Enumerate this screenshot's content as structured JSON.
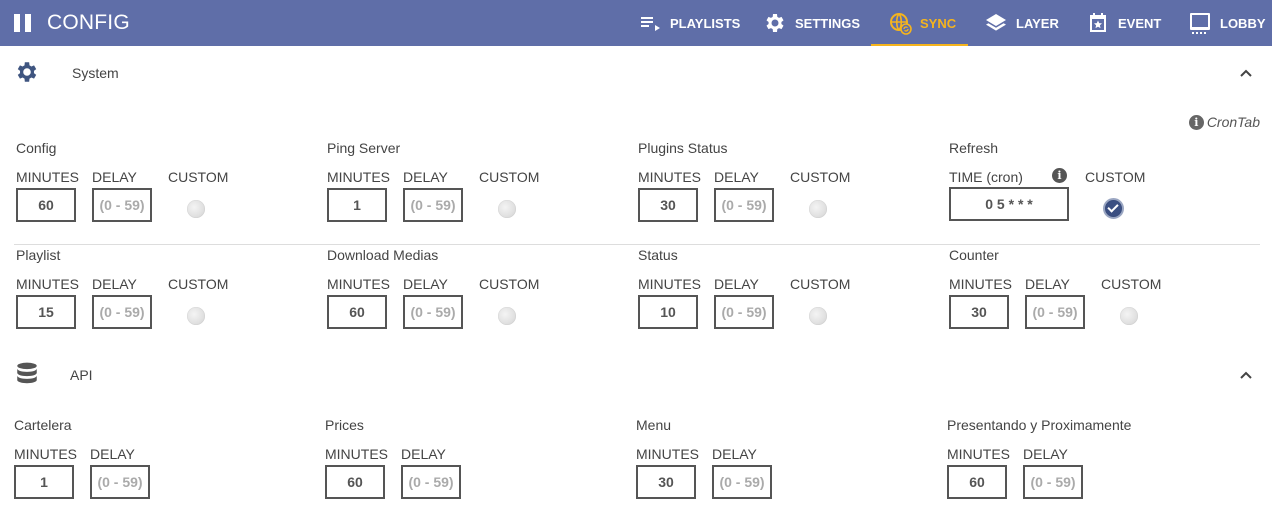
{
  "app": {
    "title": "CONFIG"
  },
  "nav": [
    {
      "label": "PLAYLISTS",
      "icon": "playlist-play-icon",
      "active": false
    },
    {
      "label": "SETTINGS",
      "icon": "gear-icon",
      "active": false
    },
    {
      "label": "SYNC",
      "icon": "globe-sync-icon",
      "active": true
    },
    {
      "label": "LAYER",
      "icon": "layers-icon",
      "active": false
    },
    {
      "label": "EVENT",
      "icon": "calendar-star-icon",
      "active": false
    },
    {
      "label": "LOBBY",
      "icon": "monitor-icon",
      "active": false
    }
  ],
  "colors": {
    "topbar": "#5f6ea8",
    "active": "#f5b41d",
    "checked": "#3b4f82"
  },
  "system": {
    "title": "System",
    "crontab_label": "CronTab",
    "groups": [
      {
        "title": "Config",
        "minutes_label": "MINUTES",
        "delay_label": "DELAY",
        "custom_label": "CUSTOM",
        "minutes": "60",
        "delay_placeholder": "(0 - 59)"
      },
      {
        "title": "Ping Server",
        "minutes_label": "MINUTES",
        "delay_label": "DELAY",
        "custom_label": "CUSTOM",
        "minutes": "1",
        "delay_placeholder": "(0 - 59)"
      },
      {
        "title": "Plugins Status",
        "minutes_label": "MINUTES",
        "delay_label": "DELAY",
        "custom_label": "CUSTOM",
        "minutes": "30",
        "delay_placeholder": "(0 - 59)"
      },
      {
        "title": "Refresh",
        "time_label": "TIME (cron)",
        "custom_label": "CUSTOM",
        "cron": "0 5 * * *"
      },
      {
        "title": "Playlist",
        "minutes_label": "MINUTES",
        "delay_label": "DELAY",
        "custom_label": "CUSTOM",
        "minutes": "15",
        "delay_placeholder": "(0 - 59)"
      },
      {
        "title": "Download Medias",
        "minutes_label": "MINUTES",
        "delay_label": "DELAY",
        "custom_label": "CUSTOM",
        "minutes": "60",
        "delay_placeholder": "(0 - 59)"
      },
      {
        "title": "Status",
        "minutes_label": "MINUTES",
        "delay_label": "DELAY",
        "custom_label": "CUSTOM",
        "minutes": "10",
        "delay_placeholder": "(0 - 59)"
      },
      {
        "title": "Counter",
        "minutes_label": "MINUTES",
        "delay_label": "DELAY",
        "custom_label": "CUSTOM",
        "minutes": "30",
        "delay_placeholder": "(0 - 59)"
      }
    ]
  },
  "api": {
    "title": "API",
    "groups": [
      {
        "title": "Cartelera",
        "minutes_label": "MINUTES",
        "delay_label": "DELAY",
        "minutes": "1",
        "delay_placeholder": "(0 - 59)"
      },
      {
        "title": "Prices",
        "minutes_label": "MINUTES",
        "delay_label": "DELAY",
        "minutes": "60",
        "delay_placeholder": "(0 - 59)"
      },
      {
        "title": "Menu",
        "minutes_label": "MINUTES",
        "delay_label": "DELAY",
        "minutes": "30",
        "delay_placeholder": "(0 - 59)"
      },
      {
        "title": "Presentando y Proximamente",
        "minutes_label": "MINUTES",
        "delay_label": "DELAY",
        "minutes": "60",
        "delay_placeholder": "(0 - 59)"
      }
    ]
  }
}
